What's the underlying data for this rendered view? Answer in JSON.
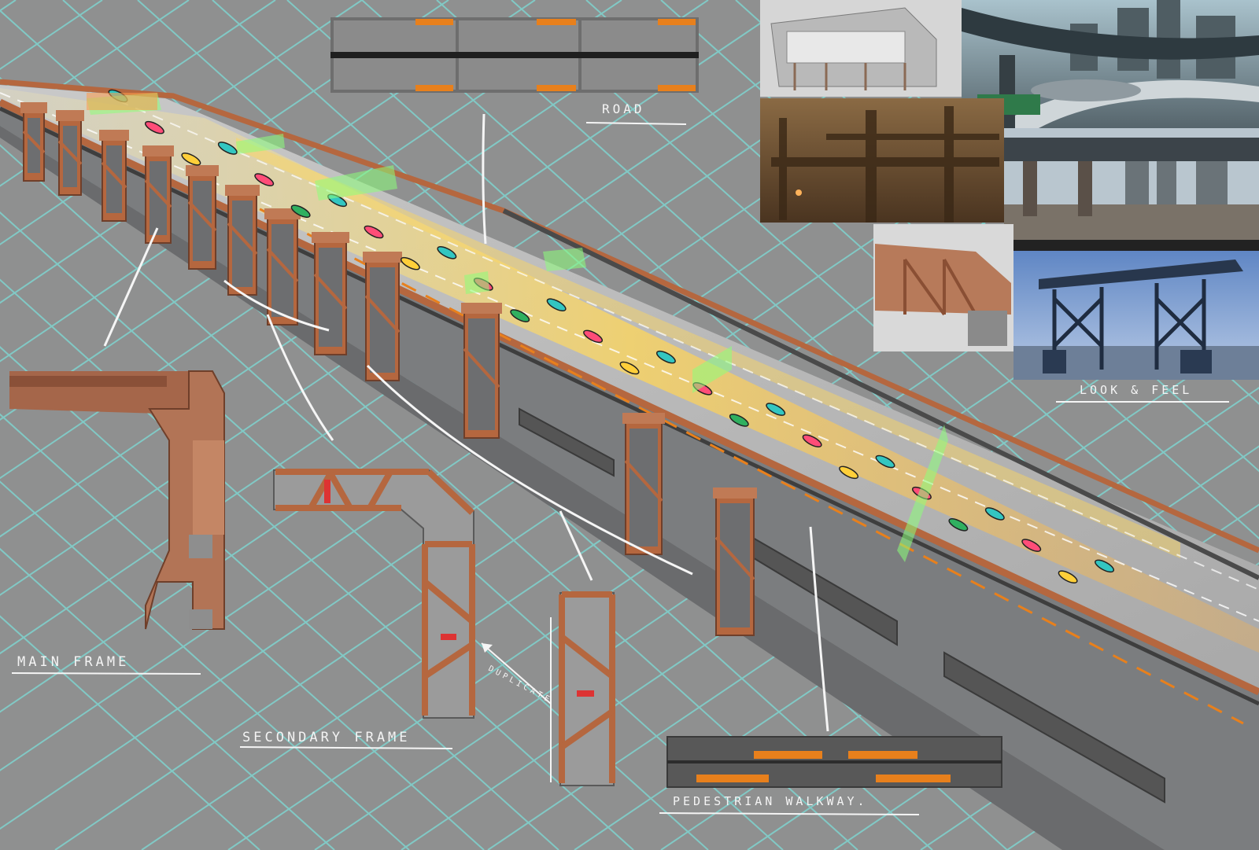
{
  "labels": {
    "road": "ROAD",
    "look_and_feel": "LOOK & FEEL",
    "main_frame": "MAIN FRAME",
    "secondary_frame": "SECONDARY FRAME",
    "duplicate": "DUPLICATE :)",
    "pedestrian_walkway": "PEDESTRIAN WALKWAY."
  },
  "reference_images": [
    {
      "name": "ref-structure-render"
    },
    {
      "name": "ref-highway-city"
    },
    {
      "name": "ref-industrial-painting"
    },
    {
      "name": "ref-overpass-city"
    },
    {
      "name": "ref-bridge-module-closeup"
    },
    {
      "name": "ref-blue-pier"
    }
  ],
  "colors": {
    "background": "#8f9090",
    "grid": "#7fd3cf",
    "frame_rust": "#b5673f",
    "road_gray": "#bdbdbd",
    "stripe_orange": "#e8801c",
    "glow_yellow": "#ffd75a",
    "sketch_white": "#f5f5f5"
  }
}
